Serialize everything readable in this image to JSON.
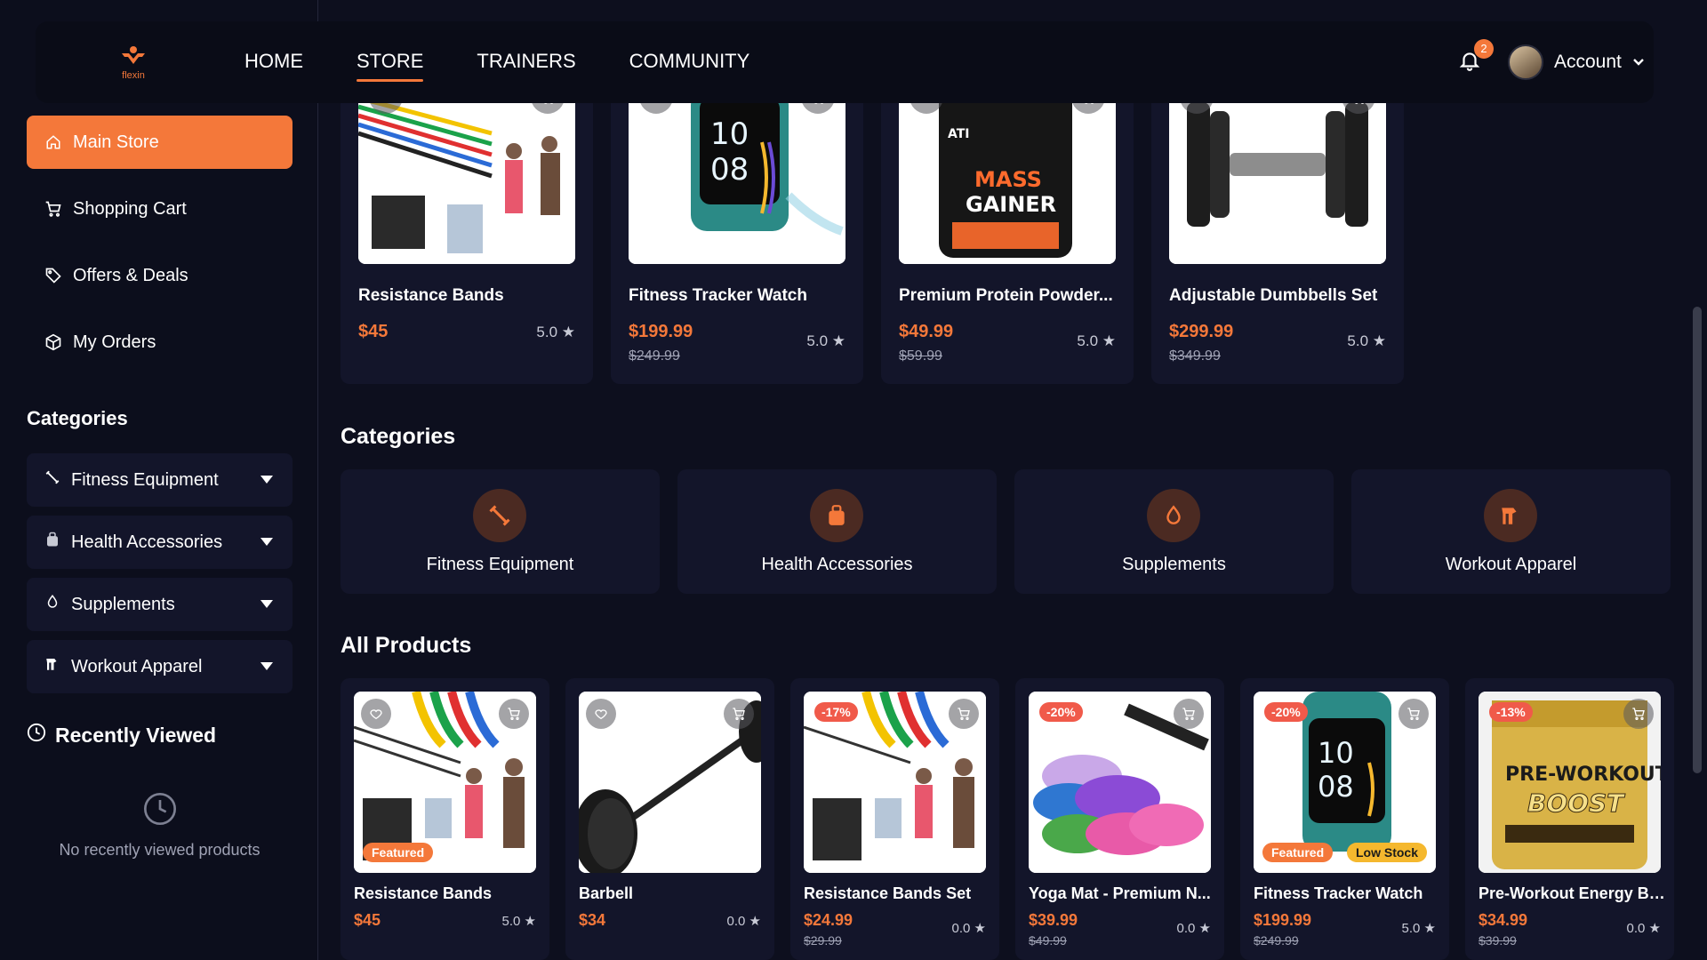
{
  "brand": {
    "name": "flexin",
    "accent": "#f4783a"
  },
  "nav": {
    "links": [
      "HOME",
      "STORE",
      "TRAINERS",
      "COMMUNITY"
    ],
    "active": "STORE",
    "notifications": "2",
    "account_label": "Account"
  },
  "sidebar": {
    "items": [
      {
        "label": "Main Store",
        "icon": "home-icon",
        "active": true
      },
      {
        "label": "Shopping Cart",
        "icon": "cart-icon"
      },
      {
        "label": "Offers & Deals",
        "icon": "tag-icon"
      },
      {
        "label": "My Orders",
        "icon": "box-icon"
      }
    ],
    "categories_title": "Categories",
    "categories": [
      {
        "label": "Fitness Equipment",
        "icon": "dumbbell-icon"
      },
      {
        "label": "Health Accessories",
        "icon": "bag-icon"
      },
      {
        "label": "Supplements",
        "icon": "drop-icon"
      },
      {
        "label": "Workout Apparel",
        "icon": "shirt-icon"
      }
    ],
    "recent_title": "Recently Viewed",
    "recent_empty": "No recently viewed products"
  },
  "featured": [
    {
      "name": "Resistance Bands",
      "price": "$45",
      "old_price": "",
      "rating": "5.0 ★"
    },
    {
      "name": "Fitness Tracker Watch",
      "price": "$199.99",
      "old_price": "$249.99",
      "rating": "5.0 ★"
    },
    {
      "name": "Premium Protein Powder...",
      "price": "$49.99",
      "old_price": "$59.99",
      "rating": "5.0 ★"
    },
    {
      "name": "Adjustable Dumbbells Set",
      "price": "$299.99",
      "old_price": "$349.99",
      "rating": "5.0 ★"
    }
  ],
  "categories_section": {
    "title": "Categories",
    "items": [
      "Fitness Equipment",
      "Health Accessories",
      "Supplements",
      "Workout Apparel"
    ]
  },
  "all_products": {
    "title": "All Products",
    "items": [
      {
        "name": "Resistance Bands",
        "price": "$45",
        "old_price": "",
        "rating": "5.0 ★",
        "discount": "",
        "tags": [
          "Featured"
        ]
      },
      {
        "name": "Barbell",
        "price": "$34",
        "old_price": "",
        "rating": "0.0 ★",
        "discount": "",
        "tags": []
      },
      {
        "name": "Resistance Bands Set",
        "price": "$24.99",
        "old_price": "$29.99",
        "rating": "0.0 ★",
        "discount": "-17%",
        "tags": []
      },
      {
        "name": "Yoga Mat - Premium N...",
        "price": "$39.99",
        "old_price": "$49.99",
        "rating": "0.0 ★",
        "discount": "-20%",
        "tags": []
      },
      {
        "name": "Fitness Tracker Watch",
        "price": "$199.99",
        "old_price": "$249.99",
        "rating": "5.0 ★",
        "discount": "-20%",
        "tags": [
          "Featured",
          "Low Stock"
        ]
      },
      {
        "name": "Pre-Workout Energy Bo...",
        "price": "$34.99",
        "old_price": "$39.99",
        "rating": "0.0 ★",
        "discount": "-13%",
        "tags": []
      }
    ]
  }
}
